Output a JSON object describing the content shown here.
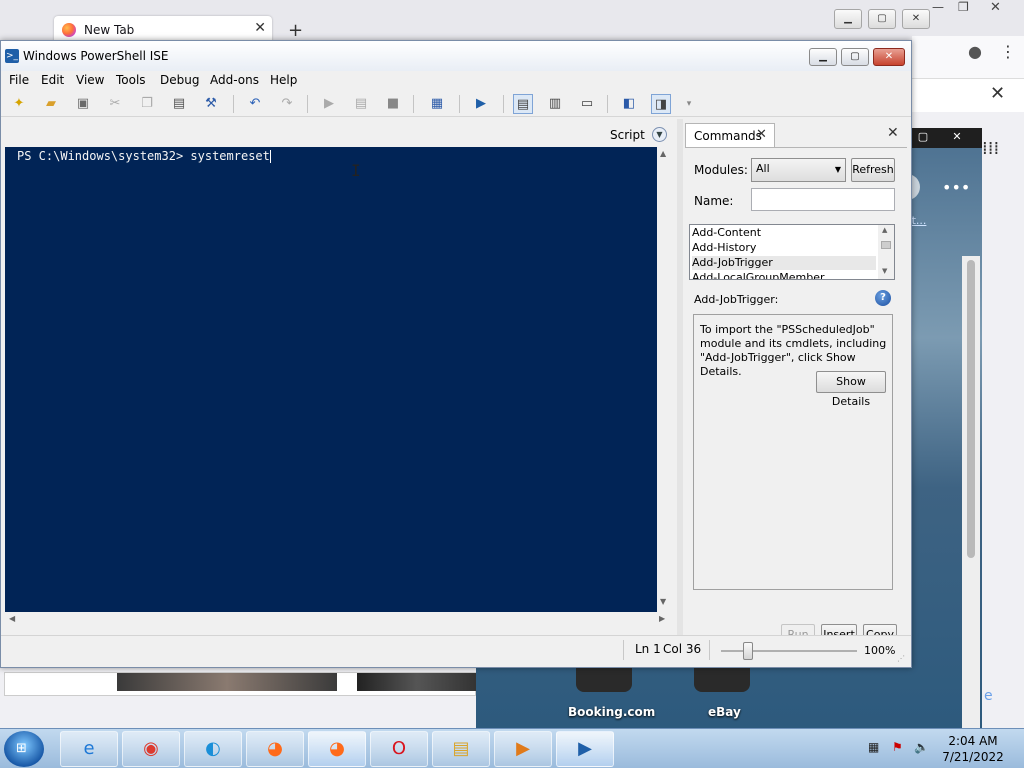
{
  "browser": {
    "tab_title": "New Tab",
    "tab_close": "✕",
    "new_tab": "+",
    "bar_close": "✕"
  },
  "start_page": {
    "link_text": "rit...",
    "tiles": [
      {
        "label": "Booking.com"
      },
      {
        "label": "eBay"
      }
    ]
  },
  "ise": {
    "title": "Windows PowerShell ISE",
    "menu": [
      "File",
      "Edit",
      "View",
      "Tools",
      "Debug",
      "Add-ons",
      "Help"
    ],
    "script_label": "Script",
    "console": {
      "prompt": "PS C:\\Windows\\system32> ",
      "input": "systemreset"
    },
    "commands": {
      "tab_label": "Commands",
      "modules_label": "Modules:",
      "modules_value": "All",
      "refresh_label": "Refresh",
      "name_label": "Name:",
      "name_value": "",
      "list_items": [
        "Add-Content",
        "Add-History",
        "Add-JobTrigger",
        "Add-LocalGroupMember"
      ],
      "selected_item": "Add-JobTrigger",
      "selected_heading": "Add-JobTrigger:",
      "detail_text": "To import the \"PSScheduledJob\" module and its cmdlets, including \"Add-JobTrigger\", click Show Details.",
      "show_details_label": "Show Details",
      "run_label": "Run",
      "insert_label": "Insert",
      "copy_label": "Copy"
    },
    "status": {
      "line": "Ln 1",
      "col": "Col 36",
      "zoom": "100%",
      "zoom_value": 100
    }
  },
  "taskbar": {
    "clock_time": "2:04 AM",
    "clock_date": "7/21/2022"
  }
}
